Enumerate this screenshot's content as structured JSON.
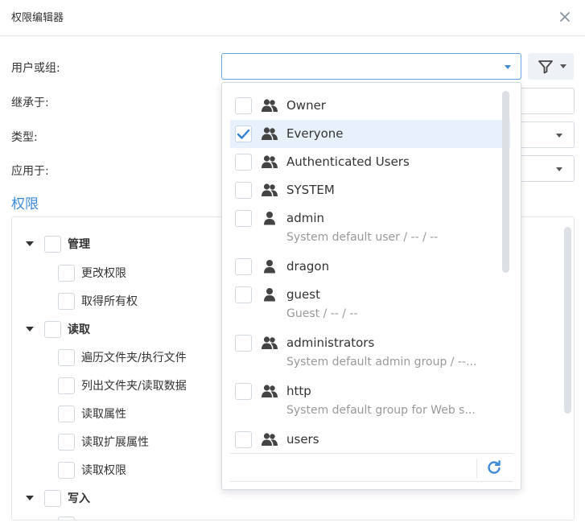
{
  "dialog": {
    "title": "权限编辑器"
  },
  "form": {
    "user_or_group_label": "用户或组:",
    "inherited_from_label": "继承于:",
    "type_label": "类型:",
    "applies_to_label": "应用于:",
    "user_or_group_value": ""
  },
  "permissions": {
    "title": "权限",
    "tree": [
      {
        "label": "管理",
        "level": 0
      },
      {
        "label": "更改权限",
        "level": 1
      },
      {
        "label": "取得所有权",
        "level": 1
      },
      {
        "label": "读取",
        "level": 0
      },
      {
        "label": "遍历文件夹/执行文件",
        "level": 1
      },
      {
        "label": "列出文件夹/读取数据",
        "level": 1
      },
      {
        "label": "读取属性",
        "level": 1
      },
      {
        "label": "读取扩展属性",
        "level": 1
      },
      {
        "label": "读取权限",
        "level": 1
      },
      {
        "label": "写入",
        "level": 0
      }
    ]
  },
  "dropdown": {
    "items": [
      {
        "name": "Owner",
        "kind": "group",
        "desc": "",
        "checked": false
      },
      {
        "name": "Everyone",
        "kind": "group",
        "desc": "",
        "checked": true
      },
      {
        "name": "Authenticated Users",
        "kind": "group",
        "desc": "",
        "checked": false
      },
      {
        "name": "SYSTEM",
        "kind": "group",
        "desc": "",
        "checked": false
      },
      {
        "name": "admin",
        "kind": "user",
        "desc": "System default user / -- / --",
        "checked": false
      },
      {
        "name": "dragon",
        "kind": "user",
        "desc": "",
        "checked": false
      },
      {
        "name": "guest",
        "kind": "user",
        "desc": "Guest / -- / --",
        "checked": false
      },
      {
        "name": "administrators",
        "kind": "group",
        "desc": "System default admin group / --...",
        "checked": false
      },
      {
        "name": "http",
        "kind": "group",
        "desc": "System default group for Web s...",
        "checked": false
      },
      {
        "name": "users",
        "kind": "group",
        "desc": "",
        "checked": false
      }
    ]
  },
  "colors": {
    "accent": "#3f8ad8",
    "check": "#2f7fd3",
    "selected_row": "#e8f1fb"
  }
}
